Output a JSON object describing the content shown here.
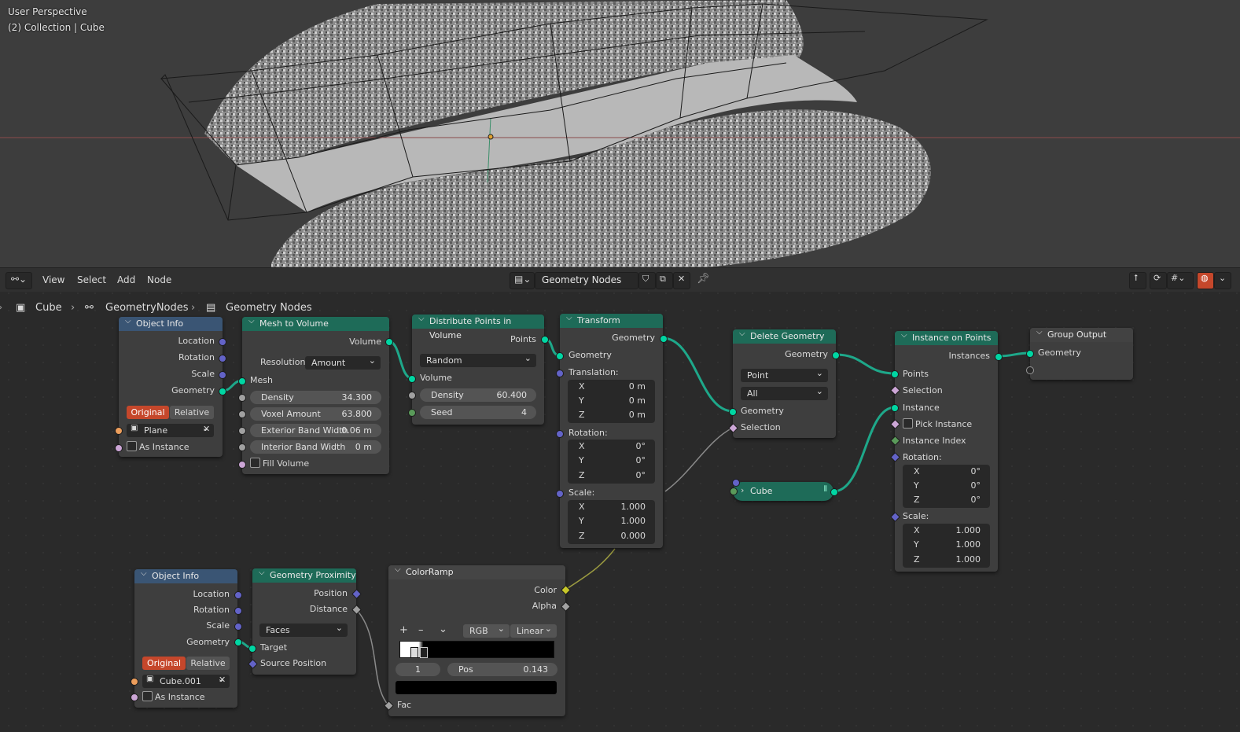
{
  "viewport": {
    "perspective_label": "User Perspective",
    "collection_label": "(2) Collection | Cube"
  },
  "header": {
    "menu": [
      "View",
      "Select",
      "Add",
      "Node"
    ],
    "tree_name": "Geometry Nodes"
  },
  "breadcrumb": {
    "object": "Cube",
    "modifier": "GeometryNodes",
    "tree": "Geometry Nodes"
  },
  "colors": {
    "geometry_socket": "#00d6a3",
    "vector_socket": "#6363c7",
    "input_header": "#3a5574",
    "geometry_header": "#1e6b58",
    "active_toggle": "#c5472b"
  },
  "nodes": {
    "object_info_1": {
      "title": "Object Info",
      "outputs": [
        "Location",
        "Rotation",
        "Scale",
        "Geometry"
      ],
      "toggle": [
        "Original",
        "Relative"
      ],
      "object": "Plane",
      "as_instance": "As Instance"
    },
    "mesh_to_volume": {
      "title": "Mesh to Volume",
      "out": "Volume",
      "resolution_label": "Resolution",
      "resolution_value": "Amount",
      "mesh": "Mesh",
      "density_label": "Density",
      "density": "34.300",
      "voxel_label": "Voxel Amount",
      "voxel": "63.800",
      "ext_label": "Exterior Band Width",
      "ext": "0.06 m",
      "int_label": "Interior Band Width",
      "int": "0 m",
      "fill": "Fill Volume"
    },
    "distribute": {
      "title": "Distribute Points in Volume",
      "out": "Points",
      "mode": "Random",
      "volume": "Volume",
      "density_label": "Density",
      "density": "60.400",
      "seed_label": "Seed",
      "seed": "4"
    },
    "transform": {
      "title": "Transform",
      "out": "Geometry",
      "in": "Geometry",
      "translation": "Translation:",
      "tx": "0 m",
      "ty": "0 m",
      "tz": "0 m",
      "rotation": "Rotation:",
      "rx": "0°",
      "ry": "0°",
      "rz": "0°",
      "scale": "Scale:",
      "sx": "1.000",
      "sy": "1.000",
      "sz": "0.000",
      "X": "X",
      "Y": "Y",
      "Z": "Z"
    },
    "delete_geometry": {
      "title": "Delete Geometry",
      "out": "Geometry",
      "domain": "Point",
      "mode": "All",
      "in": "Geometry",
      "selection": "Selection"
    },
    "cube": {
      "title": "Cube"
    },
    "instance_on_points": {
      "title": "Instance on Points",
      "out": "Instances",
      "points": "Points",
      "selection": "Selection",
      "instance": "Instance",
      "pick": "Pick Instance",
      "index": "Instance Index",
      "rotation": "Rotation:",
      "rx": "0°",
      "ry": "0°",
      "rz": "0°",
      "scale": "Scale:",
      "sx": "1.000",
      "sy": "1.000",
      "sz": "1.000"
    },
    "group_output": {
      "title": "Group Output",
      "in": "Geometry"
    },
    "object_info_2": {
      "title": "Object Info",
      "outputs": [
        "Location",
        "Rotation",
        "Scale",
        "Geometry"
      ],
      "toggle": [
        "Original",
        "Relative"
      ],
      "object": "Cube.001",
      "as_instance": "As Instance"
    },
    "geometry_proximity": {
      "title": "Geometry Proximity",
      "out_pos": "Position",
      "out_dist": "Distance",
      "mode": "Faces",
      "target": "Target",
      "source": "Source Position"
    },
    "colorramp": {
      "title": "ColorRamp",
      "color": "Color",
      "alpha": "Alpha",
      "color_mode": "RGB",
      "interp": "Linear",
      "stop_index": "1",
      "pos_label": "Pos",
      "pos": "0.143",
      "fac": "Fac",
      "plus": "+",
      "minus": "–",
      "chev": "⌄"
    }
  }
}
